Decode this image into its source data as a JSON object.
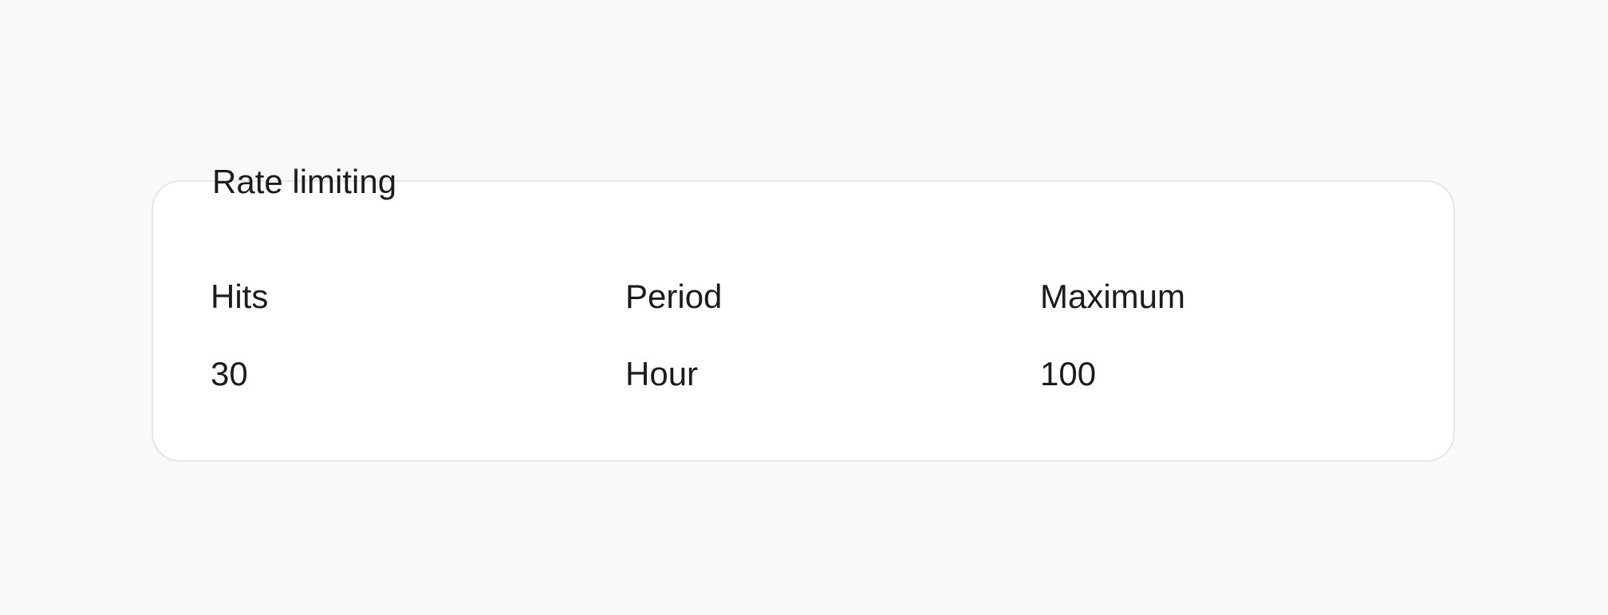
{
  "section": {
    "title": "Rate limiting"
  },
  "fields": [
    {
      "label": "Hits",
      "value": "30"
    },
    {
      "label": "Period",
      "value": "Hour"
    },
    {
      "label": "Maximum",
      "value": "100"
    }
  ],
  "colors": {
    "page_background": "#f9f9f9",
    "card_background": "#ffffff",
    "card_border": "#e6e6e6",
    "text": "#1c1c1c"
  }
}
